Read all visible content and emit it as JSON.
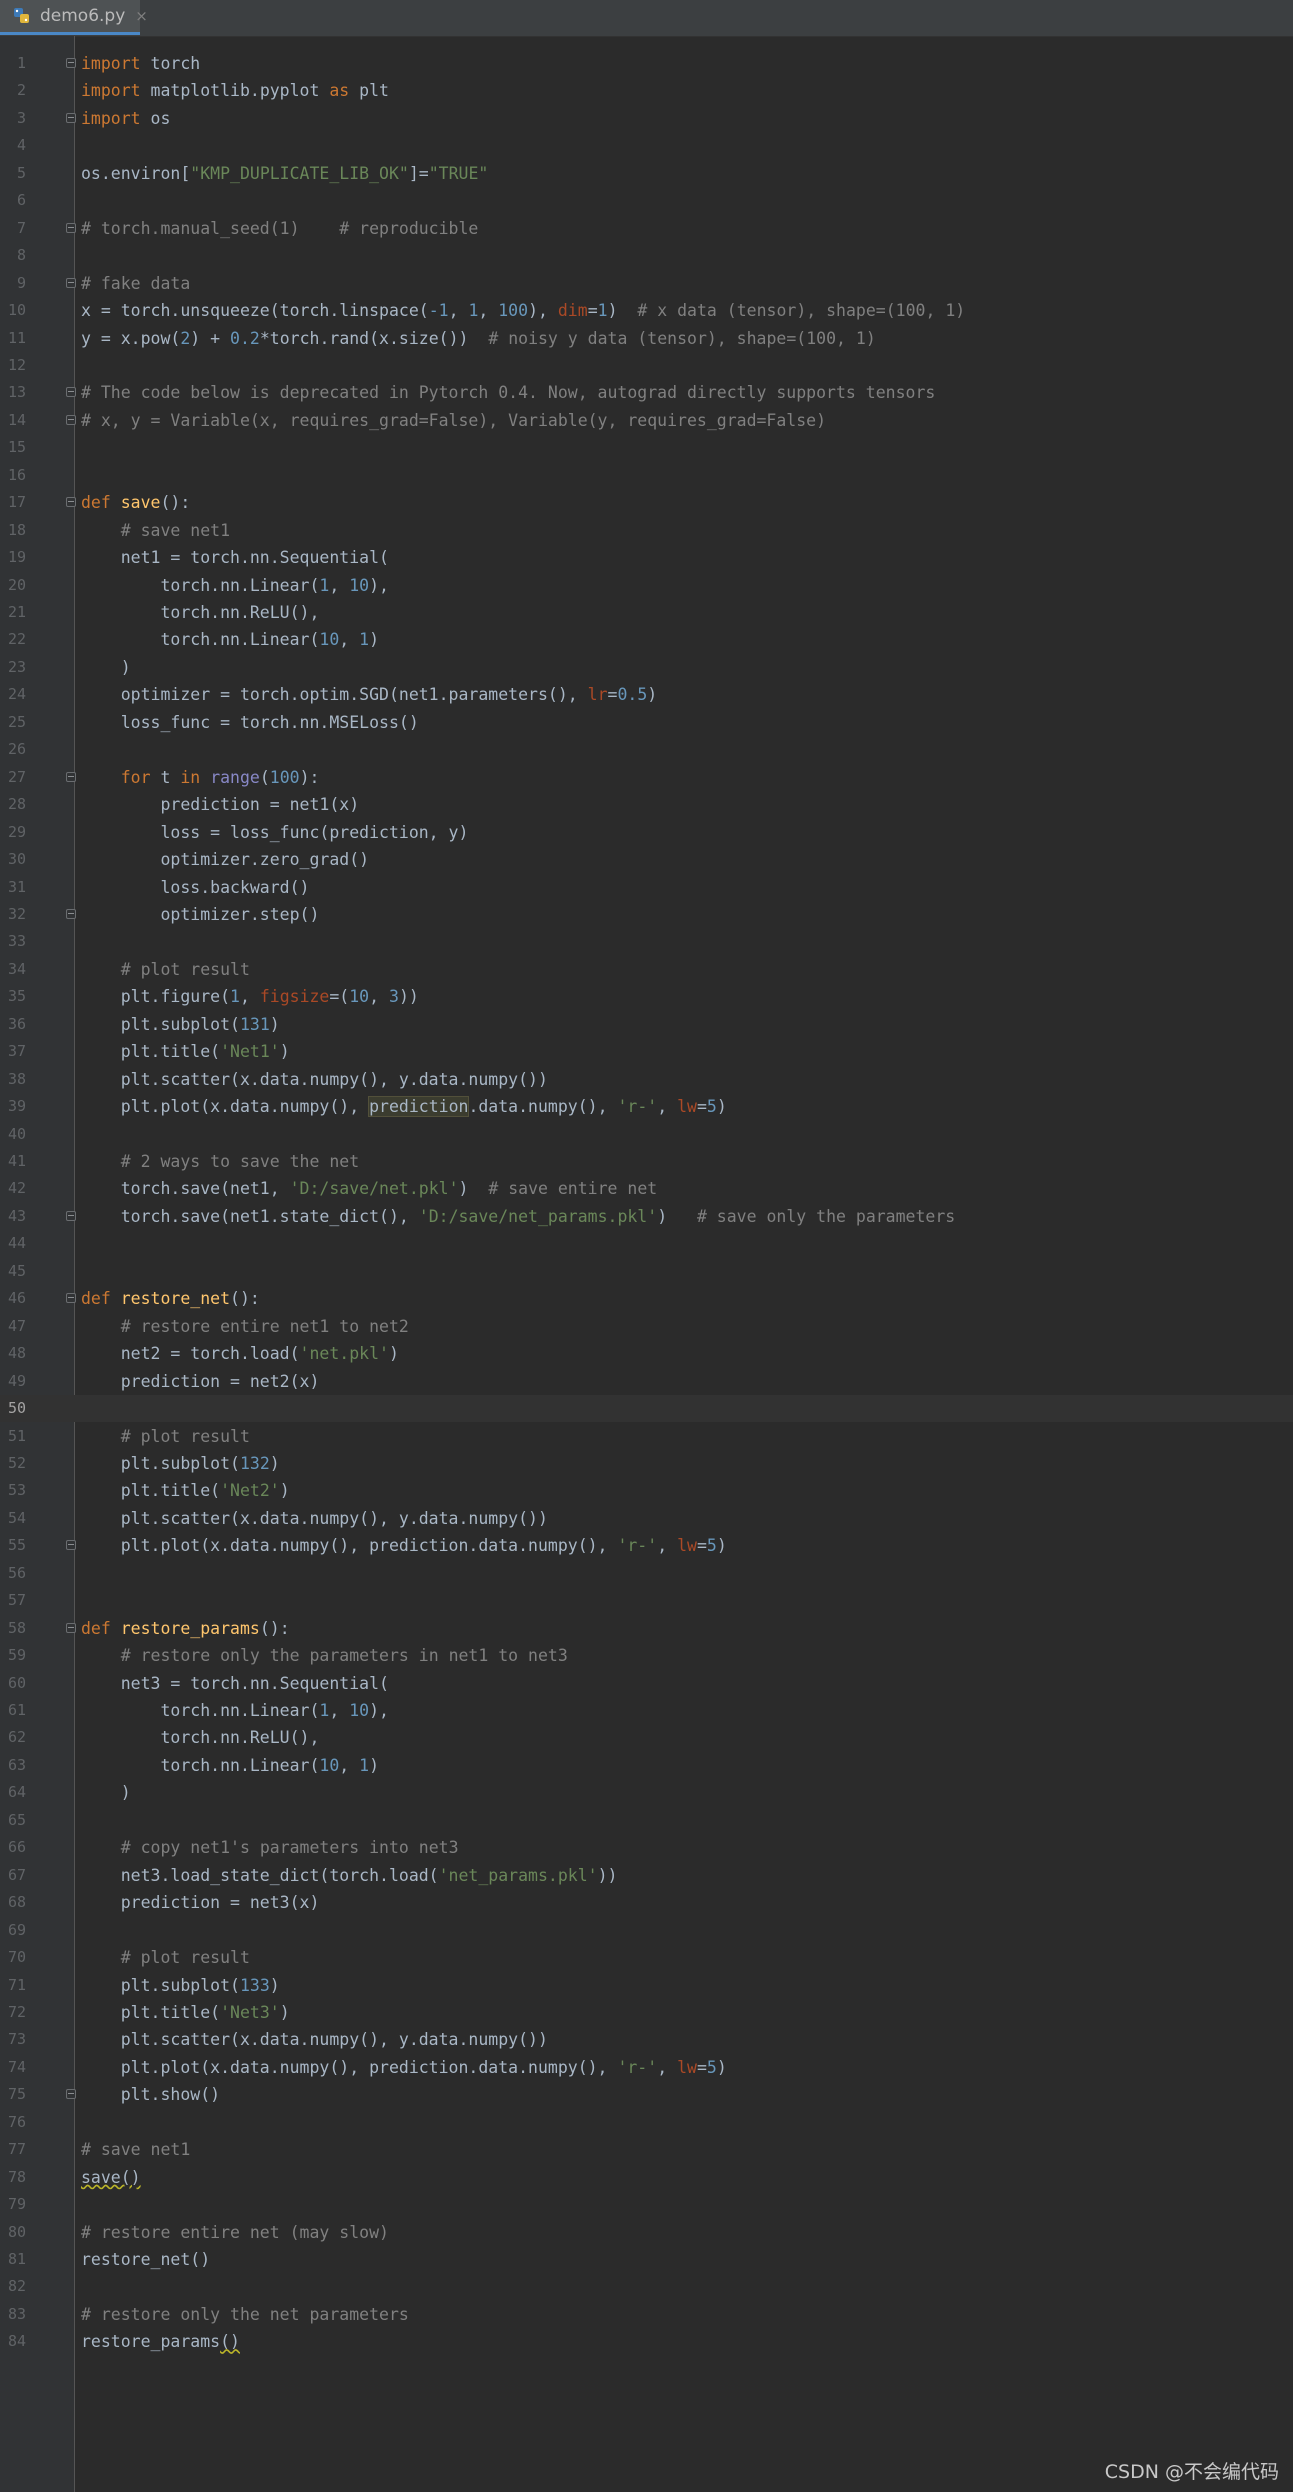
{
  "tab": {
    "filename": "demo6.py",
    "close": "×"
  },
  "watermark": "CSDN @不会编代码",
  "current_line": 50,
  "lines": [
    {
      "n": "1",
      "fold": true,
      "t": [
        [
          "import",
          "kw"
        ],
        [
          " torch",
          ""
        ]
      ]
    },
    {
      "n": "2",
      "t": [
        [
          "import",
          "kw"
        ],
        [
          " matplotlib.pyplot ",
          ""
        ],
        [
          "as",
          "kw"
        ],
        [
          " plt",
          ""
        ]
      ]
    },
    {
      "n": "3",
      "fold": true,
      "t": [
        [
          "import",
          "kw"
        ],
        [
          " os",
          ""
        ]
      ]
    },
    {
      "n": "4",
      "t": []
    },
    {
      "n": "5",
      "t": [
        [
          "os.environ[",
          ""
        ],
        [
          "\"KMP_DUPLICATE_LIB_OK\"",
          "str"
        ],
        [
          "]=",
          ""
        ],
        [
          "\"TRUE\"",
          "str"
        ]
      ]
    },
    {
      "n": "6",
      "t": []
    },
    {
      "n": "7",
      "fold": true,
      "t": [
        [
          "# torch.manual_seed(1)    # reproducible",
          "cm"
        ]
      ]
    },
    {
      "n": "8",
      "t": []
    },
    {
      "n": "9",
      "fold": true,
      "t": [
        [
          "# fake data",
          "cm"
        ]
      ]
    },
    {
      "n": "10",
      "t": [
        [
          "x = torch.unsqueeze(torch.linspace(",
          ""
        ],
        [
          "-1",
          "num"
        ],
        [
          ", ",
          ""
        ],
        [
          "1",
          "num"
        ],
        [
          ", ",
          ""
        ],
        [
          "100",
          "num"
        ],
        [
          "), ",
          ""
        ],
        [
          "dim",
          "kwa"
        ],
        [
          "=",
          ""
        ],
        [
          "1",
          "num"
        ],
        [
          ")  ",
          ""
        ],
        [
          "# x data (tensor), shape=(100, 1)",
          "cm"
        ]
      ]
    },
    {
      "n": "11",
      "t": [
        [
          "y = x.pow(",
          ""
        ],
        [
          "2",
          "num"
        ],
        [
          ") + ",
          ""
        ],
        [
          "0.2",
          "num"
        ],
        [
          "*torch.rand(x.size())  ",
          ""
        ],
        [
          "# noisy y data (tensor), shape=(100, 1)",
          "cm"
        ]
      ]
    },
    {
      "n": "12",
      "t": []
    },
    {
      "n": "13",
      "fold": true,
      "t": [
        [
          "# The code below is deprecated in Pytorch 0.4. Now, autograd directly supports tensors",
          "cm"
        ]
      ]
    },
    {
      "n": "14",
      "fold": true,
      "t": [
        [
          "# x, y = Variable(x, requires_grad=False), Variable(y, requires_grad=False)",
          "cm"
        ]
      ]
    },
    {
      "n": "15",
      "t": []
    },
    {
      "n": "16",
      "t": []
    },
    {
      "n": "17",
      "fold": true,
      "t": [
        [
          "def",
          "kw"
        ],
        [
          " ",
          ""
        ],
        [
          "save",
          "fn"
        ],
        [
          "():",
          ""
        ]
      ]
    },
    {
      "n": "18",
      "t": [
        [
          "    ",
          ""
        ],
        [
          "# save net1",
          "cm"
        ]
      ]
    },
    {
      "n": "19",
      "t": [
        [
          "    net1 = torch.nn.Sequential(",
          ""
        ]
      ]
    },
    {
      "n": "20",
      "t": [
        [
          "        torch.nn.Linear(",
          ""
        ],
        [
          "1",
          "num"
        ],
        [
          ", ",
          ""
        ],
        [
          "10",
          "num"
        ],
        [
          "),",
          ""
        ]
      ]
    },
    {
      "n": "21",
      "t": [
        [
          "        torch.nn.ReLU(),",
          ""
        ]
      ]
    },
    {
      "n": "22",
      "t": [
        [
          "        torch.nn.Linear(",
          ""
        ],
        [
          "10",
          "num"
        ],
        [
          ", ",
          ""
        ],
        [
          "1",
          "num"
        ],
        [
          ")",
          ""
        ]
      ]
    },
    {
      "n": "23",
      "t": [
        [
          "    )",
          ""
        ]
      ]
    },
    {
      "n": "24",
      "t": [
        [
          "    optimizer = torch.optim.SGD(net1.parameters(), ",
          ""
        ],
        [
          "lr",
          "kwa"
        ],
        [
          "=",
          ""
        ],
        [
          "0.5",
          "num"
        ],
        [
          ")",
          ""
        ]
      ]
    },
    {
      "n": "25",
      "t": [
        [
          "    loss_func = torch.nn.MSELoss()",
          ""
        ]
      ]
    },
    {
      "n": "26",
      "t": []
    },
    {
      "n": "27",
      "fold": true,
      "t": [
        [
          "    ",
          ""
        ],
        [
          "for",
          "kw"
        ],
        [
          " t ",
          ""
        ],
        [
          "in",
          "kw"
        ],
        [
          " ",
          ""
        ],
        [
          "range",
          "bi"
        ],
        [
          "(",
          ""
        ],
        [
          "100",
          "num"
        ],
        [
          "):",
          ""
        ]
      ]
    },
    {
      "n": "28",
      "t": [
        [
          "        prediction = net1(x)",
          ""
        ]
      ]
    },
    {
      "n": "29",
      "t": [
        [
          "        loss = loss_func(prediction, y)",
          ""
        ]
      ]
    },
    {
      "n": "30",
      "t": [
        [
          "        optimizer.zero_grad()",
          ""
        ]
      ]
    },
    {
      "n": "31",
      "t": [
        [
          "        loss.backward()",
          ""
        ]
      ]
    },
    {
      "n": "32",
      "fold": true,
      "t": [
        [
          "        optimizer.step()",
          ""
        ]
      ]
    },
    {
      "n": "33",
      "t": []
    },
    {
      "n": "34",
      "t": [
        [
          "    ",
          ""
        ],
        [
          "# plot result",
          "cm"
        ]
      ]
    },
    {
      "n": "35",
      "t": [
        [
          "    plt.figure(",
          ""
        ],
        [
          "1",
          "num"
        ],
        [
          ", ",
          ""
        ],
        [
          "figsize",
          "kwa"
        ],
        [
          "=(",
          ""
        ],
        [
          "10",
          "num"
        ],
        [
          ", ",
          ""
        ],
        [
          "3",
          "num"
        ],
        [
          "))",
          ""
        ]
      ]
    },
    {
      "n": "36",
      "t": [
        [
          "    plt.subplot(",
          ""
        ],
        [
          "131",
          "num"
        ],
        [
          ")",
          ""
        ]
      ]
    },
    {
      "n": "37",
      "t": [
        [
          "    plt.title(",
          ""
        ],
        [
          "'Net1'",
          "str"
        ],
        [
          ")",
          ""
        ]
      ]
    },
    {
      "n": "38",
      "t": [
        [
          "    plt.scatter(x.data.numpy(), y.data.numpy())",
          ""
        ]
      ]
    },
    {
      "n": "39",
      "t": [
        [
          "    plt.plot(x.data.numpy(), ",
          ""
        ],
        [
          "prediction",
          "hl"
        ],
        [
          ".data.numpy(), ",
          ""
        ],
        [
          "'r-'",
          "str"
        ],
        [
          ", ",
          ""
        ],
        [
          "lw",
          "kwa"
        ],
        [
          "=",
          ""
        ],
        [
          "5",
          "num"
        ],
        [
          ")",
          ""
        ]
      ]
    },
    {
      "n": "40",
      "t": []
    },
    {
      "n": "41",
      "t": [
        [
          "    ",
          ""
        ],
        [
          "# 2 ways to save the net",
          "cm"
        ]
      ]
    },
    {
      "n": "42",
      "t": [
        [
          "    torch.save(net1, ",
          ""
        ],
        [
          "'D:/save/net.pkl'",
          "str"
        ],
        [
          ")  ",
          ""
        ],
        [
          "# save entire net",
          "cm"
        ]
      ]
    },
    {
      "n": "43",
      "fold": true,
      "t": [
        [
          "    torch.save(net1.state_dict(), ",
          ""
        ],
        [
          "'D:/save/net_params.pkl'",
          "str"
        ],
        [
          ")   ",
          ""
        ],
        [
          "# save only the parameters",
          "cm"
        ]
      ]
    },
    {
      "n": "44",
      "t": []
    },
    {
      "n": "45",
      "t": []
    },
    {
      "n": "46",
      "fold": true,
      "t": [
        [
          "def",
          "kw"
        ],
        [
          " ",
          ""
        ],
        [
          "restore_net",
          "fn"
        ],
        [
          "():",
          ""
        ]
      ]
    },
    {
      "n": "47",
      "t": [
        [
          "    ",
          ""
        ],
        [
          "# restore entire net1 to net2",
          "cm"
        ]
      ]
    },
    {
      "n": "48",
      "t": [
        [
          "    net2 = torch.load(",
          ""
        ],
        [
          "'net.pkl'",
          "str"
        ],
        [
          ")",
          ""
        ]
      ]
    },
    {
      "n": "49",
      "t": [
        [
          "    prediction = net2(x)",
          ""
        ]
      ]
    },
    {
      "n": "50",
      "t": []
    },
    {
      "n": "51",
      "t": [
        [
          "    ",
          ""
        ],
        [
          "# plot result",
          "cm"
        ]
      ]
    },
    {
      "n": "52",
      "t": [
        [
          "    plt.subplot(",
          ""
        ],
        [
          "132",
          "num"
        ],
        [
          ")",
          ""
        ]
      ]
    },
    {
      "n": "53",
      "t": [
        [
          "    plt.title(",
          ""
        ],
        [
          "'Net2'",
          "str"
        ],
        [
          ")",
          ""
        ]
      ]
    },
    {
      "n": "54",
      "t": [
        [
          "    plt.scatter(x.data.numpy(), y.data.numpy())",
          ""
        ]
      ]
    },
    {
      "n": "55",
      "fold": true,
      "t": [
        [
          "    plt.plot(x.data.numpy(), prediction.data.numpy(), ",
          ""
        ],
        [
          "'r-'",
          "str"
        ],
        [
          ", ",
          ""
        ],
        [
          "lw",
          "kwa"
        ],
        [
          "=",
          ""
        ],
        [
          "5",
          "num"
        ],
        [
          ")",
          ""
        ]
      ]
    },
    {
      "n": "56",
      "t": []
    },
    {
      "n": "57",
      "t": []
    },
    {
      "n": "58",
      "fold": true,
      "t": [
        [
          "def",
          "kw"
        ],
        [
          " ",
          ""
        ],
        [
          "restore_params",
          "fn"
        ],
        [
          "():",
          ""
        ]
      ]
    },
    {
      "n": "59",
      "t": [
        [
          "    ",
          ""
        ],
        [
          "# restore only the parameters in net1 to net3",
          "cm"
        ]
      ]
    },
    {
      "n": "60",
      "t": [
        [
          "    net3 = torch.nn.Sequential(",
          ""
        ]
      ]
    },
    {
      "n": "61",
      "t": [
        [
          "        torch.nn.Linear(",
          ""
        ],
        [
          "1",
          "num"
        ],
        [
          ", ",
          ""
        ],
        [
          "10",
          "num"
        ],
        [
          "),",
          ""
        ]
      ]
    },
    {
      "n": "62",
      "t": [
        [
          "        torch.nn.ReLU(),",
          ""
        ]
      ]
    },
    {
      "n": "63",
      "t": [
        [
          "        torch.nn.Linear(",
          ""
        ],
        [
          "10",
          "num"
        ],
        [
          ", ",
          ""
        ],
        [
          "1",
          "num"
        ],
        [
          ")",
          ""
        ]
      ]
    },
    {
      "n": "64",
      "t": [
        [
          "    )",
          ""
        ]
      ]
    },
    {
      "n": "65",
      "t": []
    },
    {
      "n": "66",
      "t": [
        [
          "    ",
          ""
        ],
        [
          "# copy net1's parameters into net3",
          "cm"
        ]
      ]
    },
    {
      "n": "67",
      "t": [
        [
          "    net3.load_state_dict(torch.load(",
          ""
        ],
        [
          "'net_params.pkl'",
          "str"
        ],
        [
          "))",
          ""
        ]
      ]
    },
    {
      "n": "68",
      "t": [
        [
          "    prediction = net3(x)",
          ""
        ]
      ]
    },
    {
      "n": "69",
      "t": []
    },
    {
      "n": "70",
      "t": [
        [
          "    ",
          ""
        ],
        [
          "# plot result",
          "cm"
        ]
      ]
    },
    {
      "n": "71",
      "t": [
        [
          "    plt.subplot(",
          ""
        ],
        [
          "133",
          "num"
        ],
        [
          ")",
          ""
        ]
      ]
    },
    {
      "n": "72",
      "t": [
        [
          "    plt.title(",
          ""
        ],
        [
          "'Net3'",
          "str"
        ],
        [
          ")",
          ""
        ]
      ]
    },
    {
      "n": "73",
      "t": [
        [
          "    plt.scatter(x.data.numpy(), y.data.numpy())",
          ""
        ]
      ]
    },
    {
      "n": "74",
      "t": [
        [
          "    plt.plot(x.data.numpy(), prediction.data.numpy(), ",
          ""
        ],
        [
          "'r-'",
          "str"
        ],
        [
          ", ",
          ""
        ],
        [
          "lw",
          "kwa"
        ],
        [
          "=",
          ""
        ],
        [
          "5",
          "num"
        ],
        [
          ")",
          ""
        ]
      ]
    },
    {
      "n": "75",
      "fold": true,
      "t": [
        [
          "    plt.show()",
          ""
        ]
      ]
    },
    {
      "n": "76",
      "t": []
    },
    {
      "n": "77",
      "t": [
        [
          "# save net1",
          "cm"
        ]
      ]
    },
    {
      "n": "78",
      "t": [
        [
          "save()",
          "sq"
        ]
      ]
    },
    {
      "n": "79",
      "t": []
    },
    {
      "n": "80",
      "t": [
        [
          "# restore entire net (may slow)",
          "cm"
        ]
      ]
    },
    {
      "n": "81",
      "t": [
        [
          "restore_net()",
          ""
        ]
      ]
    },
    {
      "n": "82",
      "t": []
    },
    {
      "n": "83",
      "t": [
        [
          "# restore only the net parameters",
          "cm"
        ]
      ]
    },
    {
      "n": "84",
      "t": [
        [
          "restore_params",
          ""
        ],
        [
          "()",
          "sq"
        ]
      ]
    }
  ]
}
